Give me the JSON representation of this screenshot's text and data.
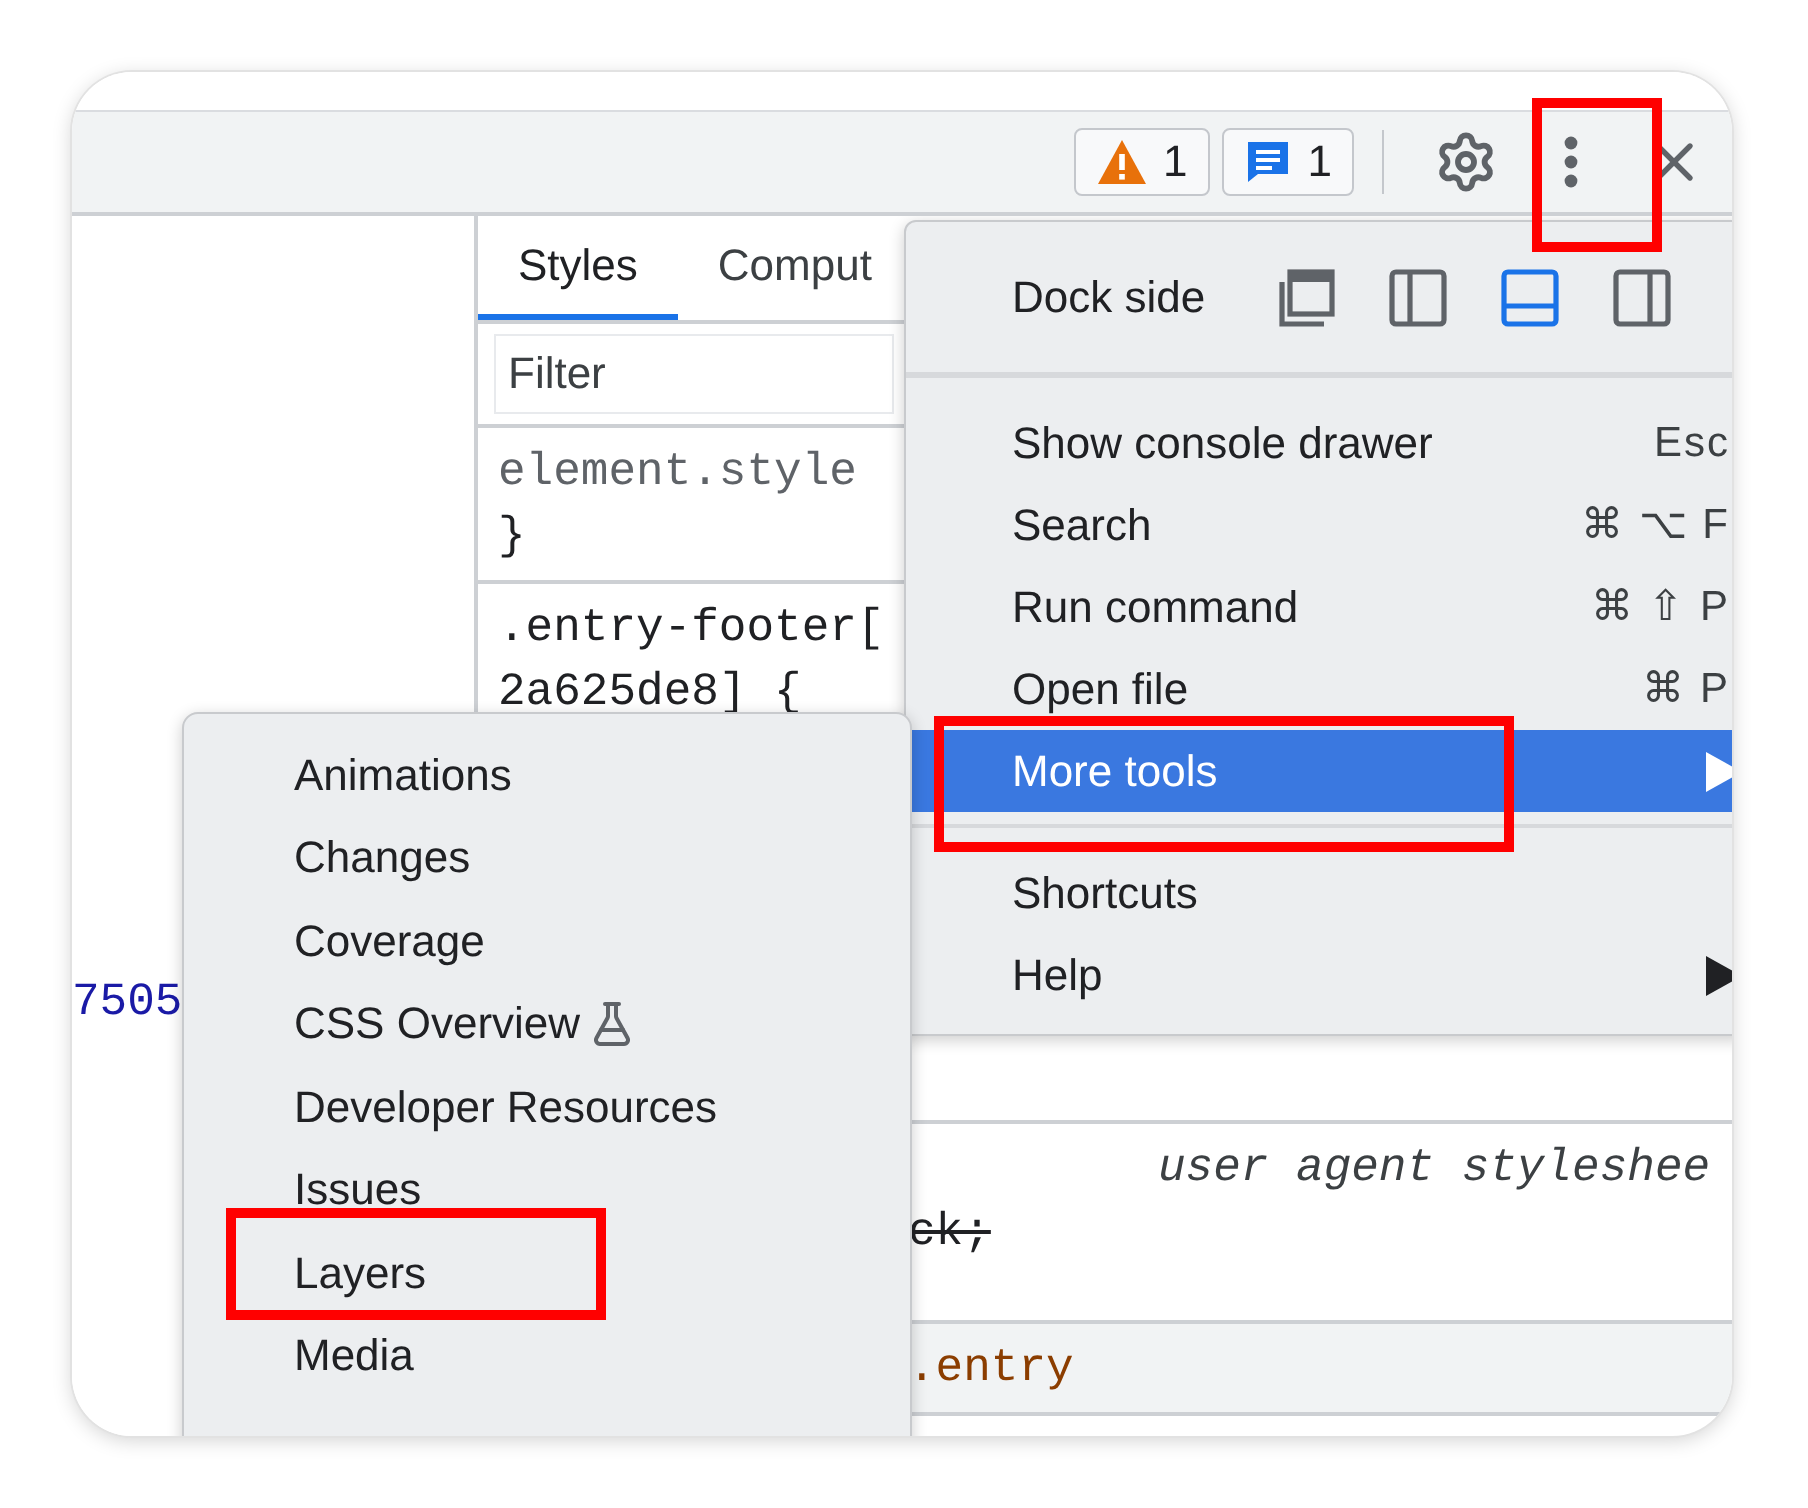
{
  "toolbar": {
    "warnings": {
      "count": "1"
    },
    "messages": {
      "count": "1"
    },
    "menu_button": {
      "highlighted": true
    }
  },
  "left_pane": {
    "code_fragment": "7505"
  },
  "styles_pane": {
    "tabs": [
      {
        "label": "Styles",
        "selected": true
      },
      {
        "label": "Comput",
        "selected": false
      }
    ],
    "filter": {
      "placeholder": "Filter"
    },
    "rules": [
      {
        "kind": "rule",
        "lines": [
          {
            "text": "element.style",
            "muted": true,
            "struck": false
          },
          {
            "text": "}",
            "muted": false,
            "struck": false
          }
        ]
      },
      {
        "kind": "rule",
        "lines": [
          {
            "text": ".entry-footer[",
            "muted": false,
            "struck": false
          },
          {
            "text": "2a625de8] {",
            "muted": false,
            "struck": false
          }
        ]
      },
      {
        "kind": "rule",
        "origin": "user agent styleshee",
        "lines": [
          {
            "text": "ck;",
            "muted": false,
            "struck": true
          }
        ]
      },
      {
        "kind": "header",
        "lines": [
          {
            "text": ".entry",
            "muted": false,
            "struck": false
          }
        ]
      }
    ]
  },
  "main_menu": {
    "dock_side": {
      "label": "Dock side",
      "options": [
        {
          "kind": "undock",
          "selected": false
        },
        {
          "kind": "left",
          "selected": false
        },
        {
          "kind": "bottom",
          "selected": true
        },
        {
          "kind": "right",
          "selected": false
        }
      ]
    },
    "groups": [
      {
        "items": [
          {
            "label": "Show console drawer",
            "shortcut": "Esc",
            "hovered": false,
            "submenu": false,
            "highlighted": false
          },
          {
            "label": "Search",
            "shortcut": "⌘ ⌥ F",
            "hovered": false,
            "submenu": false,
            "highlighted": false
          },
          {
            "label": "Run command",
            "shortcut": "⌘ ⇧ P",
            "hovered": false,
            "submenu": false,
            "highlighted": false
          },
          {
            "label": "Open file",
            "shortcut": "⌘ P",
            "hovered": false,
            "submenu": false,
            "highlighted": false
          },
          {
            "label": "More tools",
            "hovered": true,
            "submenu": true,
            "highlighted": true
          }
        ]
      },
      {
        "items": [
          {
            "label": "Shortcuts",
            "hovered": false,
            "submenu": false,
            "highlighted": false
          },
          {
            "label": "Help",
            "hovered": false,
            "submenu": true,
            "highlighted": false
          }
        ]
      }
    ]
  },
  "more_tools_menu": {
    "items": [
      {
        "label": "Animations",
        "experimental": false,
        "highlighted": false
      },
      {
        "label": "Changes",
        "experimental": false,
        "highlighted": false
      },
      {
        "label": "Coverage",
        "experimental": false,
        "highlighted": false
      },
      {
        "label": "CSS Overview",
        "experimental": true,
        "highlighted": false
      },
      {
        "label": "Developer Resources",
        "experimental": false,
        "highlighted": false
      },
      {
        "label": "Issues",
        "experimental": false,
        "highlighted": false
      },
      {
        "label": "Layers",
        "experimental": false,
        "highlighted": true
      },
      {
        "label": "Media",
        "experimental": false,
        "highlighted": false
      }
    ]
  }
}
